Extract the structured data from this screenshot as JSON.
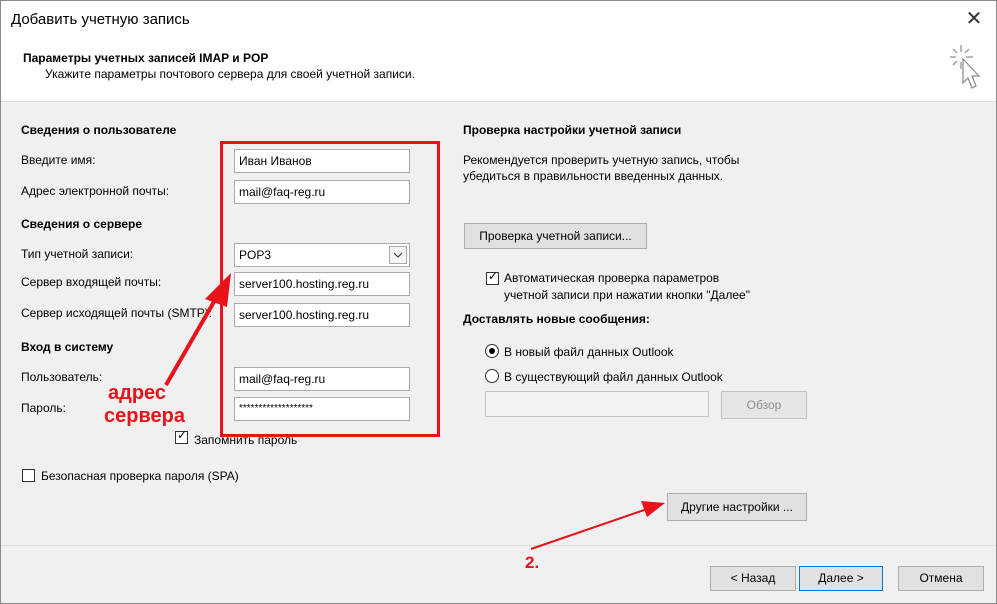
{
  "window": {
    "title": "Добавить учетную запись",
    "close_label": "✕"
  },
  "header": {
    "title": "Параметры учетных записей IMAP и POP",
    "subtitle": "Укажите параметры почтового сервера для своей учетной записи."
  },
  "user_info": {
    "section": "Сведения о пользователе",
    "name_label": "Введите имя:",
    "name_value": "Иван Иванов",
    "email_label": "Адрес электронной почты:",
    "email_value": "mail@faq-reg.ru"
  },
  "server_info": {
    "section": "Сведения о сервере",
    "account_type_label": "Тип учетной записи:",
    "account_type_value": "POP3",
    "incoming_label": "Сервер входящей почты:",
    "incoming_value": "server100.hosting.reg.ru",
    "outgoing_label": "Сервер исходящей почты (SMTP):",
    "outgoing_value": "server100.hosting.reg.ru"
  },
  "logon": {
    "section": "Вход в систему",
    "user_label": "Пользователь:",
    "user_value": "mail@faq-reg.ru",
    "password_label": "Пароль:",
    "password_value": "*******************",
    "remember_label": "Запомнить пароль",
    "remember_checked": true,
    "spa_label": "Безопасная проверка пароля (SPA)",
    "spa_checked": false
  },
  "test": {
    "section": "Проверка настройки учетной записи",
    "description_line1": "Рекомендуется проверить учетную запись, чтобы",
    "description_line2": "убедиться в правильности введенных данных.",
    "test_button": "Проверка учетной записи...",
    "auto_check_line1": "Автоматическая проверка параметров",
    "auto_check_line2": "учетной записи при нажатии кнопки \"Далее\"",
    "auto_check_checked": true
  },
  "deliver": {
    "section": "Доставлять новые сообщения:",
    "option_new": "В новый файл данных Outlook",
    "option_existing": "В существующий файл данных Outlook",
    "selected": "new",
    "path_value": "",
    "browse_button": "Обзор"
  },
  "more_settings_button": "Другие настройки ...",
  "footer": {
    "back": "< Назад",
    "next": "Далее >",
    "cancel": "Отмена"
  },
  "annotations": {
    "label_line1": "адрес",
    "label_line2": "сервера",
    "step": "2.",
    "color": "#e8121b"
  },
  "icons": {
    "wand": "wizard-wand-icon",
    "dropdown": "chevron-down-icon",
    "close": "close-icon"
  }
}
